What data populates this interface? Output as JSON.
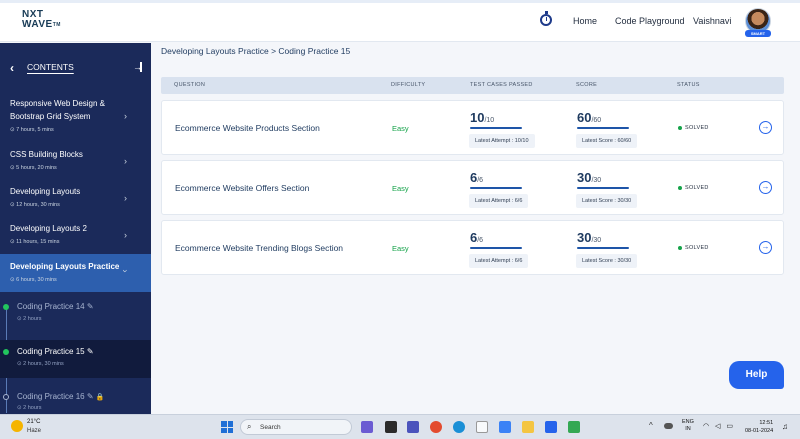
{
  "header": {
    "logo_line1": "NXT",
    "logo_line2": "WAVE",
    "logo_tm": "TM",
    "nav_home": "Home",
    "nav_playground": "Code Playground",
    "user_name": "Vaishnavi",
    "avatar_badge": "SMART"
  },
  "sidebar": {
    "back_glyph": "‹",
    "contents_label": "CONTENTS",
    "modules": [
      {
        "title": "Responsive Web Design & Bootstrap Grid System",
        "meta": "⊙ 7 hours, 5 mins"
      },
      {
        "title": "CSS Building Blocks",
        "meta": "⊙ 5 hours, 20 mins"
      },
      {
        "title": "Developing Layouts",
        "meta": "⊙ 12 hours, 30 mins"
      },
      {
        "title": "Developing Layouts 2",
        "meta": "⊙ 11 hours, 15 mins"
      },
      {
        "title": "Developing Layouts Practice",
        "meta": "⊙ 6 hours, 30 mins"
      }
    ],
    "practices": [
      {
        "title": "Coding Practice 14",
        "meta": "⊙ 2 hours",
        "status": "done"
      },
      {
        "title": "Coding Practice 15",
        "meta": "⊙ 2 hours, 30 mins",
        "status": "done"
      },
      {
        "title": "Coding Practice 16",
        "meta": "⊙ 2 hours",
        "status": "locked"
      }
    ]
  },
  "main": {
    "breadcrumb": "Developing Layouts Practice > Coding Practice 15",
    "columns": {
      "question": "QUESTION",
      "difficulty": "DIFFICULTY",
      "test_cases": "TEST CASES PASSED",
      "score": "SCORE",
      "status": "STATUS"
    },
    "rows": [
      {
        "question": "Ecommerce Website Products Section",
        "difficulty": "Easy",
        "tests_passed": "10",
        "tests_total": "/10",
        "latest_attempt": "Latest Attempt : 10/10",
        "score": "60",
        "score_total": "/60",
        "latest_score": "Latest Score : 60/60",
        "status": "SOLVED"
      },
      {
        "question": "Ecommerce Website Offers Section",
        "difficulty": "Easy",
        "tests_passed": "6",
        "tests_total": "/6",
        "latest_attempt": "Latest Attempt : 6/6",
        "score": "30",
        "score_total": "/30",
        "latest_score": "Latest Score : 30/30",
        "status": "SOLVED"
      },
      {
        "question": "Ecommerce Website Trending Blogs Section",
        "difficulty": "Easy",
        "tests_passed": "6",
        "tests_total": "/6",
        "latest_attempt": "Latest Attempt : 6/6",
        "score": "30",
        "score_total": "/30",
        "latest_score": "Latest Score : 30/30",
        "status": "SOLVED"
      }
    ],
    "help_label": "Help"
  },
  "taskbar": {
    "temperature": "21°C",
    "weather": "Haze",
    "search_placeholder": "Search",
    "lang_line1": "ENG",
    "lang_line2": "IN",
    "time": "12:51",
    "date": "08-01-2024"
  },
  "colors": {
    "sidebar_bg": "#1b2a5a",
    "active_module": "#2d5fae",
    "accent": "#2563eb",
    "easy": "#16a34a",
    "solved_dot": "#16a34a"
  }
}
